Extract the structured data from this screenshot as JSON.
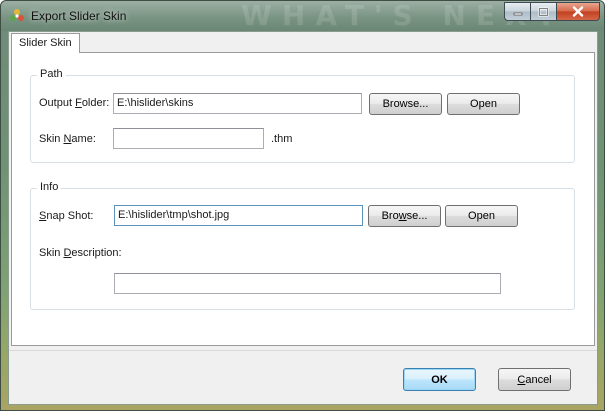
{
  "window": {
    "title": "Export Slider Skin",
    "watermark": "WHAT'S NEXT"
  },
  "tabs": [
    {
      "label": "Slider Skin"
    }
  ],
  "path_group": {
    "title": "Path",
    "output_folder": {
      "label_pre": "Output ",
      "label_key": "F",
      "label_post": "older:",
      "value": "E:\\hislider\\skins",
      "browse_label": "Browse...",
      "open_label": "Open"
    },
    "skin_name": {
      "label_pre": "Skin ",
      "label_key": "N",
      "label_post": "ame:",
      "value": "",
      "suffix": ".thm"
    }
  },
  "info_group": {
    "title": "Info",
    "snap_shot": {
      "label_key": "S",
      "label_post": "nap Shot:",
      "value": "E:\\hislider\\tmp\\shot.jpg",
      "browse_pre": "Bro",
      "browse_key": "w",
      "browse_post": "se...",
      "open_label": "Open"
    },
    "skin_description": {
      "label_pre": "Skin ",
      "label_key": "D",
      "label_post": "escription:",
      "value": ""
    }
  },
  "footer": {
    "ok_label": "OK",
    "cancel_key": "C",
    "cancel_post": "ancel"
  },
  "colors": {
    "accent_border": "#3c7fb1",
    "close_button": "#c2401f"
  }
}
